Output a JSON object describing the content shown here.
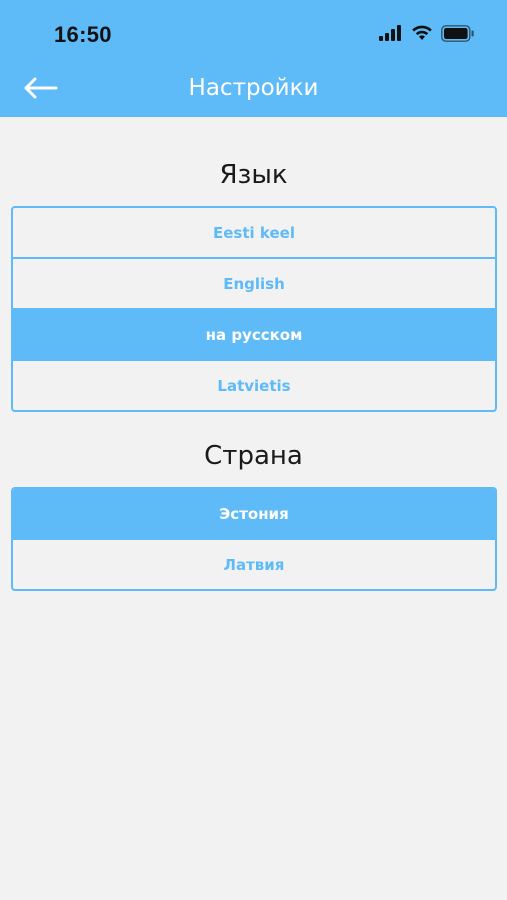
{
  "status_bar": {
    "time": "16:50"
  },
  "header": {
    "title": "Настройки"
  },
  "language_section": {
    "title": "Язык",
    "options": [
      {
        "label": "Eesti keel",
        "selected": false
      },
      {
        "label": "English",
        "selected": false
      },
      {
        "label": "на русском",
        "selected": true
      },
      {
        "label": "Latvietis",
        "selected": false
      }
    ]
  },
  "country_section": {
    "title": "Страна",
    "options": [
      {
        "label": "Эстония",
        "selected": true
      },
      {
        "label": "Латвия",
        "selected": false
      }
    ]
  },
  "colors": {
    "accent": "#5fbaf8",
    "background": "#f2f2f2",
    "selected_text": "#ffffff"
  }
}
